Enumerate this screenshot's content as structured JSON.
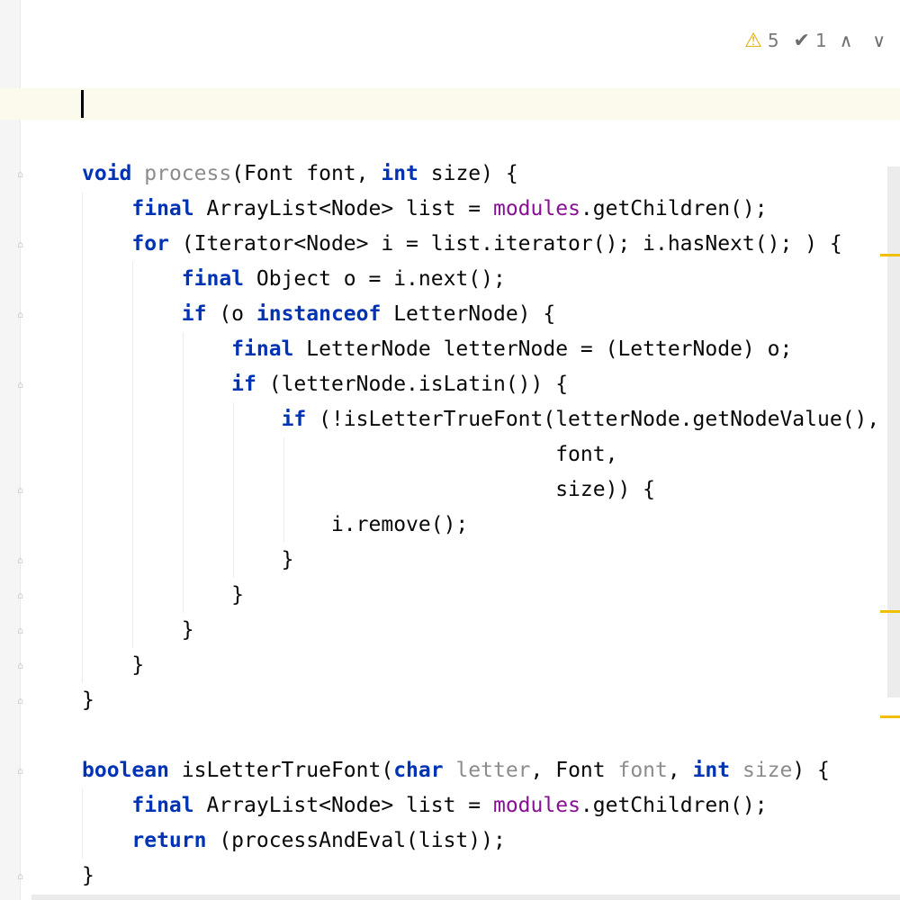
{
  "inspections": {
    "warnings_icon": "warning-triangle-icon",
    "warnings_count": "5",
    "weak_warnings_icon": "double-check-icon",
    "weak_warnings_count": "1",
    "prev_label": "∧",
    "next_label": "∨"
  },
  "colors": {
    "keyword": "#0033b3",
    "field": "#871094",
    "unused": "#8c8c8c",
    "caret_line": "#fcfaed",
    "marker": "#f0c000"
  },
  "code_lines": [
    {
      "indent": "",
      "segments": [
        {
          "t": "void",
          "c": "kw"
        },
        {
          "t": " "
        },
        {
          "t": "process",
          "c": "unused"
        },
        {
          "t": "(Font font, "
        },
        {
          "t": "int",
          "c": "kw"
        },
        {
          "t": " size) {"
        }
      ]
    },
    {
      "indent": "    ",
      "segments": [
        {
          "t": "final",
          "c": "kw"
        },
        {
          "t": " ArrayList<Node> list = "
        },
        {
          "t": "modules",
          "c": "fld"
        },
        {
          "t": ".getChildren();"
        }
      ]
    },
    {
      "indent": "    ",
      "segments": [
        {
          "t": "for",
          "c": "kw"
        },
        {
          "t": " (Iterator<Node> i = list.iterator(); i.hasNext(); ) {"
        }
      ]
    },
    {
      "indent": "        ",
      "segments": [
        {
          "t": "final",
          "c": "kw"
        },
        {
          "t": " Object o = i.next();"
        }
      ]
    },
    {
      "indent": "        ",
      "segments": [
        {
          "t": "if",
          "c": "kw"
        },
        {
          "t": " (o "
        },
        {
          "t": "instanceof",
          "c": "kw"
        },
        {
          "t": " LetterNode) {"
        }
      ]
    },
    {
      "indent": "            ",
      "segments": [
        {
          "t": "final",
          "c": "kw"
        },
        {
          "t": " LetterNode letterNode = (LetterNode) o;"
        }
      ]
    },
    {
      "indent": "            ",
      "segments": [
        {
          "t": "if",
          "c": "kw"
        },
        {
          "t": " (letterNode.isLatin()) {"
        }
      ]
    },
    {
      "indent": "                ",
      "segments": [
        {
          "t": "if",
          "c": "kw"
        },
        {
          "t": " (!isLetterTrueFont(letterNode.getNodeValue(),"
        }
      ]
    },
    {
      "indent": "                                      ",
      "segments": [
        {
          "t": "font,"
        }
      ]
    },
    {
      "indent": "                                      ",
      "segments": [
        {
          "t": "size)) {"
        }
      ]
    },
    {
      "indent": "                    ",
      "segments": [
        {
          "t": "i.remove();"
        }
      ]
    },
    {
      "indent": "                ",
      "segments": [
        {
          "t": "}"
        }
      ]
    },
    {
      "indent": "            ",
      "segments": [
        {
          "t": "}"
        }
      ]
    },
    {
      "indent": "        ",
      "segments": [
        {
          "t": "}"
        }
      ]
    },
    {
      "indent": "    ",
      "segments": [
        {
          "t": "}"
        }
      ]
    },
    {
      "indent": "",
      "segments": [
        {
          "t": "}"
        }
      ]
    },
    {
      "indent": "",
      "segments": []
    },
    {
      "indent": "",
      "segments": [
        {
          "t": "boolean",
          "c": "kw"
        },
        {
          "t": " isLetterTrueFont("
        },
        {
          "t": "char",
          "c": "kw"
        },
        {
          "t": " "
        },
        {
          "t": "letter",
          "c": "unused"
        },
        {
          "t": ", Font "
        },
        {
          "t": "font",
          "c": "unused"
        },
        {
          "t": ", "
        },
        {
          "t": "int",
          "c": "kw"
        },
        {
          "t": " "
        },
        {
          "t": "size",
          "c": "unused"
        },
        {
          "t": ") {"
        }
      ]
    },
    {
      "indent": "    ",
      "segments": [
        {
          "t": "final",
          "c": "kw"
        },
        {
          "t": " ArrayList<Node> list = "
        },
        {
          "t": "modules",
          "c": "fld"
        },
        {
          "t": ".getChildren();"
        }
      ]
    },
    {
      "indent": "    ",
      "segments": [
        {
          "t": "return",
          "c": "kw"
        },
        {
          "t": " (processAndEval(list));"
        }
      ]
    },
    {
      "indent": "",
      "segments": [
        {
          "t": "}"
        }
      ]
    }
  ]
}
